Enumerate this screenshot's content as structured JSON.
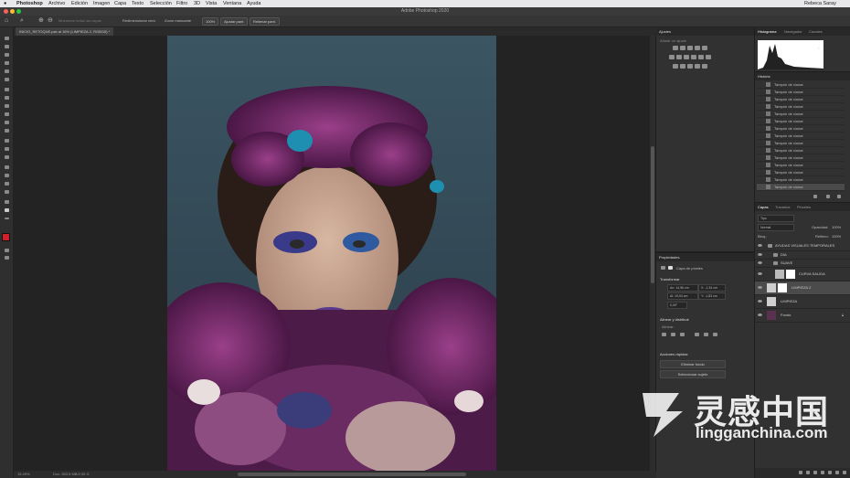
{
  "menubar": {
    "apple": "",
    "app": "Photoshop",
    "items": [
      "Archivo",
      "Edición",
      "Imagen",
      "Capa",
      "Texto",
      "Selección",
      "Filtro",
      "3D",
      "Vista",
      "Ventana",
      "Ayuda"
    ],
    "user": "Rebeca Saray"
  },
  "window": {
    "title": "Adobe Photoshop 2020"
  },
  "options": {
    "sample_size": "Muestrear todas las capas",
    "check1": "Redimensionar vent.",
    "check2": "Zoom manuante",
    "zoom": "100%",
    "fit_button": "Ajustar pant.",
    "fill_button": "Rellenar pant."
  },
  "document": {
    "tab": "INICIO_RETOQUE.psb al 16% (LIMPIEZA 2, RGB/16) *"
  },
  "status": {
    "zoom": "15,49%",
    "doc": "Doc: 263,5 MB/2,95 G"
  },
  "adjustments": {
    "title": "Ajustes",
    "subtitle": "Añadir un ajuste"
  },
  "histogram": {
    "tabs": [
      "Histograma",
      "Navegador",
      "Canales"
    ]
  },
  "history": {
    "title": "Historia",
    "item": "Tampón de clonar",
    "count": 15
  },
  "properties": {
    "title": "Propiedades",
    "kind": "Capa de píxeles",
    "transform": "Transformar",
    "w": "An: 14,96 cm",
    "x": "X: -1,34 cm",
    "h": "Al: 19,94 cm",
    "y": "Y: -1,83 cm",
    "angle": "0,00°",
    "align": "Alinear y distribuir",
    "align_sub": "Alinear:",
    "quick": "Acciones rápidas",
    "btn1": "Eliminar fondo",
    "btn2": "Seleccionar sujeto"
  },
  "layers": {
    "tabs": [
      "Capas",
      "Trazados",
      "Pinceles"
    ],
    "filter": "Tipo",
    "blend": "Normal",
    "opacity_label": "Opacidad:",
    "opacity": "100%",
    "lock_label": "Bloq.:",
    "fill_label": "Relleno:",
    "fill": "100%",
    "rows": [
      {
        "name": "AYUDAS VISUALES TEMPORALES",
        "kind": "group"
      },
      {
        "name": "DIA",
        "kind": "group"
      },
      {
        "name": "SUAVE",
        "kind": "group"
      },
      {
        "name": "CURVA SALIDA",
        "kind": "adj"
      },
      {
        "name": "LIMPIEZA 2",
        "kind": "pixel",
        "selected": true
      },
      {
        "name": "LIMPIEZA",
        "kind": "pixel"
      },
      {
        "name": "Fondo",
        "kind": "bg"
      }
    ]
  },
  "watermark": {
    "cn": "灵感中国",
    "en": "lingganchina.com"
  },
  "colors": {
    "fg": "#d0202c",
    "bg": "#ffffff",
    "accent": "#2d8ceb"
  }
}
